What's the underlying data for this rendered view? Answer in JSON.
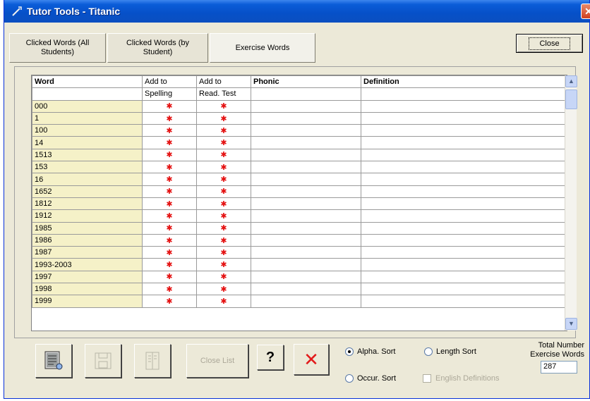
{
  "window": {
    "title": "Tutor Tools - Titanic",
    "close_glyph": "✕"
  },
  "tabs": [
    {
      "label": "Clicked Words (All Students)"
    },
    {
      "label": "Clicked Words (by Student)"
    },
    {
      "label": "Exercise Words"
    }
  ],
  "close_button": "Close",
  "grid": {
    "headers": {
      "word": "Word",
      "add_spelling_1": "Add to",
      "add_spelling_2": "Spelling",
      "add_read_1": "Add to",
      "add_read_2": "Read. Test",
      "phonic": "Phonic",
      "definition": "Definition"
    },
    "mark_glyph": "✱",
    "rows": [
      "000",
      "1",
      "100",
      "14",
      "1513",
      "153",
      "16",
      "1652",
      "1812",
      "1912",
      "1985",
      "1986",
      "1987",
      "1993-2003",
      "1997",
      "1998",
      "1999"
    ]
  },
  "toolbar": {
    "close_list": "Close List",
    "help": "?",
    "delete": "✕"
  },
  "sort": {
    "alpha": "Alpha. Sort",
    "length": "Length Sort",
    "occur": "Occur. Sort",
    "english_definitions": "English Definitions",
    "selected": "alpha"
  },
  "total": {
    "label_1": "Total Number",
    "label_2": "Exercise Words",
    "value": "287"
  },
  "scrollbar": {
    "up": "▲",
    "down": "▼"
  }
}
